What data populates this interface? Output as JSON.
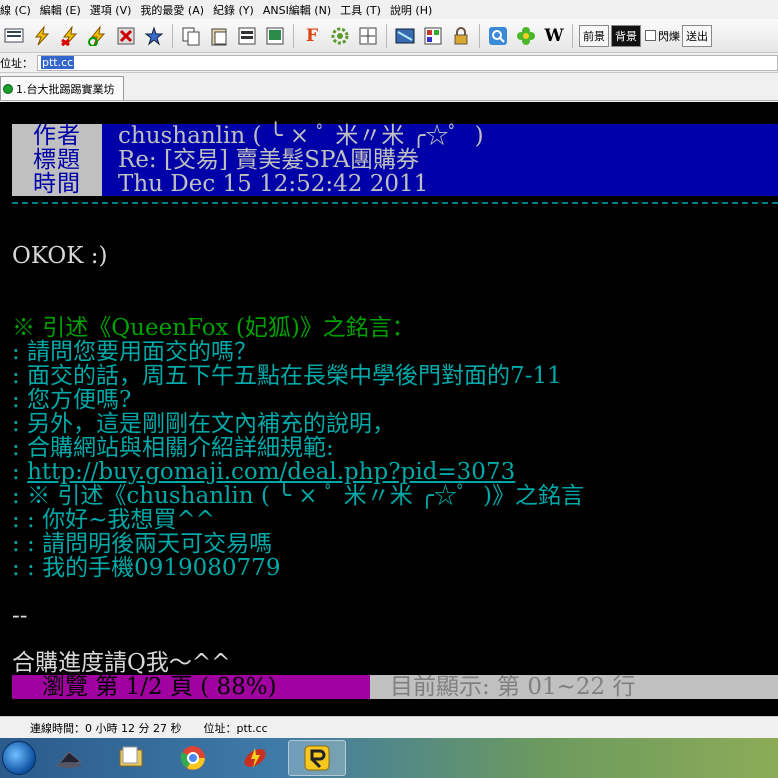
{
  "menu": [
    "線 (C)",
    "編輯 (E)",
    "選項 (V)",
    "我的最愛 (A)",
    "紀錄 (Y)",
    "ANSI編輯 (N)",
    "工具 (T)",
    "說明 (H)"
  ],
  "toolbar": {
    "icons": [
      "new-connection-icon",
      "quick-connect-icon",
      "disconnect-icon",
      "reconnect-icon",
      "close-tab-icon",
      "add-favorite-icon",
      "copy-icon",
      "paste-icon",
      "copy-ansi-icon",
      "paste-ansi-icon",
      "font-icon",
      "settings-icon",
      "fullscreen-icon",
      "screenshot-icon",
      "ansi-editor-icon",
      "lock-icon",
      "web-search-icon",
      "flower-icon",
      "wikipedia-icon"
    ],
    "font_glyph": "F",
    "wiki_glyph": "W",
    "fg_button": "前景",
    "bg_button": "背景",
    "blink_label": "閃爍",
    "send_button": "送出"
  },
  "address": {
    "label": "位址：",
    "value": "ptt.cc"
  },
  "tab": {
    "label": "1.台大批踢踢實業坊"
  },
  "article": {
    "header": [
      {
        "label": "作者",
        "value": "chushanlin ( ╰ × ﾟ 米〃米 ╭☆ﾟ  )"
      },
      {
        "label": "標題",
        "value": "Re: [交易] 賣美髮SPA團購券"
      },
      {
        "label": "時間",
        "value": "Thu Dec 15 12:52:42 2011"
      }
    ],
    "body": "OKOK :)",
    "quote_header": "※ 引述《QueenFox (妃狐)》之銘言：",
    "quote_lines": [
      ": 請問您要用面交的嗎？",
      ": 面交的話，周五下午五點在長榮中學後門對面的7-11",
      ": 您方便嗎?",
      ": 另外，這是剛剛在文內補充的說明，",
      ": 合購網站與相關介紹詳細規範:"
    ],
    "quote_url_prefix": ": ",
    "quote_url": "http://buy.gomaji.com/deal.php?pid=3073",
    "nested_quote_header": ": ※ 引述《chushanlin ( ╰ × ﾟ 米〃米 ╭☆ﾟ  )》之銘言",
    "nested_lines": [
      ": : 你好~我想買^^",
      ": : 請問明後兩天可交易嗎",
      ": : 我的手機0919080779"
    ],
    "signature_sep": "--",
    "signature": "合購進度請Q我～^^"
  },
  "status": {
    "left": "瀏覽 第 1/2 頁 ( 88%)",
    "right": "目前顯示: 第 01~22 行"
  },
  "connection": {
    "time": "連線時間：0 小時 12 分 27 秒",
    "address": "位址：ptt.cc"
  },
  "taskbar": {
    "items": [
      "media-player-icon",
      "explorer-icon",
      "chrome-icon",
      "flashget-icon",
      "pcman-icon"
    ]
  }
}
